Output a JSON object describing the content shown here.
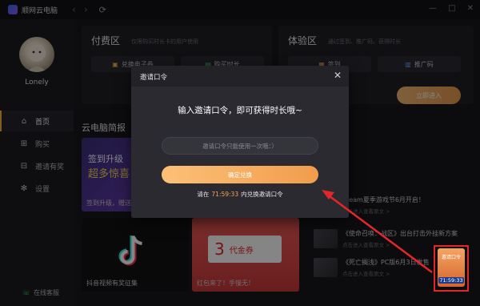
{
  "app": {
    "title": "顺网云电脑",
    "nav_back": "‹",
    "nav_forward": "›",
    "refresh": "⟳"
  },
  "window_controls": {
    "minimize": "—",
    "maximize": "□",
    "close": "✕"
  },
  "user": {
    "name": "Lonely"
  },
  "sidebar": {
    "items": [
      {
        "icon": "home-icon",
        "glyph": "⌂",
        "label": "首页"
      },
      {
        "icon": "cart-icon",
        "glyph": "⊞",
        "label": "购买"
      },
      {
        "icon": "gift-icon",
        "glyph": "⊟",
        "label": "邀请有奖"
      },
      {
        "icon": "gear-icon",
        "glyph": "✻",
        "label": "设置"
      }
    ],
    "service": {
      "glyph": "☏",
      "label": "在线客服"
    }
  },
  "paid_zone": {
    "title": "付费区",
    "subtitle": "仅限购买时长卡的用户使用",
    "btn_exchange": "兑换电子卷",
    "btn_buy": "购买时长"
  },
  "trial_zone": {
    "title": "体验区",
    "subtitle": "通过签到、推广码、获得时长",
    "btn_checkin": "签到",
    "btn_promo": "推广码",
    "btn_enter": "立即进入"
  },
  "news_section": {
    "title": "云电脑简报"
  },
  "cards": [
    {
      "caption": "签到升级，赠送时...",
      "banner_line1": "签到升级",
      "banner_line2": "超多惊喜"
    },
    {
      "caption": "抖音视频有奖征集"
    },
    {
      "caption": "红包来了！手慢无！",
      "coupon_value": "3",
      "coupon_label": "代金券"
    }
  ],
  "news": [
    {
      "title": "Steam夏季游戏节6月开启！",
      "sub": "点击进入查看原文 >"
    },
    {
      "title": "《使命召唤：战区》出台打击外挂新方案",
      "sub": "点击进入查看原文 >"
    },
    {
      "title": "《死亡搁浅》PC版6月3日发售",
      "sub": "点击进入查看原文 >"
    }
  ],
  "dialog": {
    "title": "邀请口令",
    "heading": "输入邀请口令，即可获得时长哦~",
    "input_placeholder": "邀请口令只能使用一次哦：）",
    "confirm_label": "确定兑换",
    "timer_prefix": "请在",
    "timer": "71:59:33",
    "timer_suffix": "内兑换邀请口令",
    "close": "✕"
  },
  "floating_widget": {
    "label": "邀请口令",
    "time": "71:59:33"
  },
  "colors": {
    "accent": "#f4a84e",
    "highlight": "#e3262a",
    "background": "#17171b"
  }
}
